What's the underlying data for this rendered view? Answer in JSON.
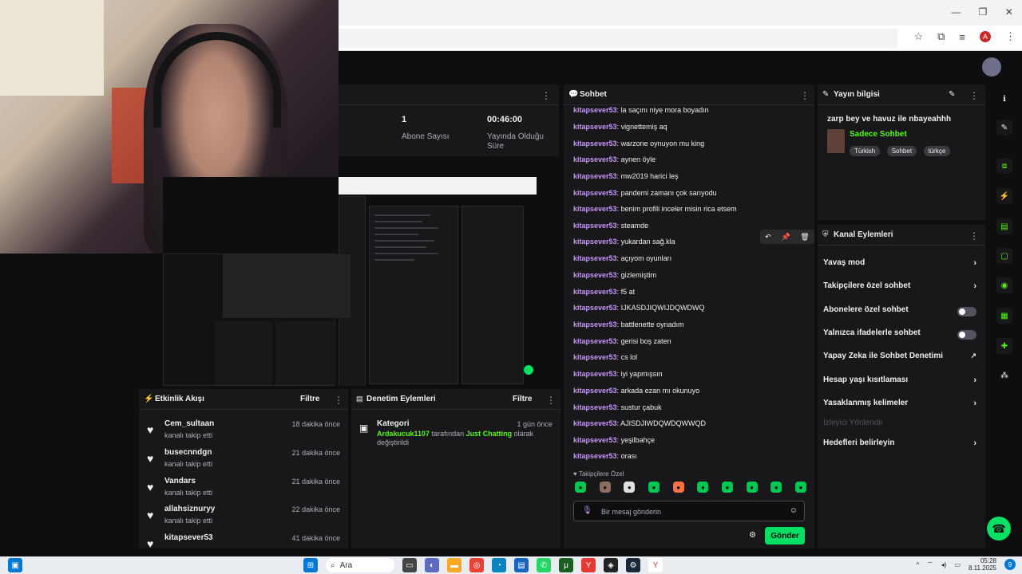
{
  "colors": {
    "accent": "#00e063",
    "username": "#c996f5",
    "bg": "#0e0e10",
    "panel": "#18181b"
  },
  "stats": [
    {
      "value": "1",
      "label": "Abone Sayısı"
    },
    {
      "value": "00:46:00",
      "label": "Yayında Olduğu Süre"
    }
  ],
  "activity": {
    "title": "Etkinlik Akışı",
    "filter_label": "Filtre",
    "items": [
      {
        "name": "Cem_sultaan",
        "sub": "kanalı takip etti",
        "time": "18 dakika önce"
      },
      {
        "name": "busecnndgn",
        "sub": "kanalı takip etti",
        "time": "21 dakika önce"
      },
      {
        "name": "Vandars",
        "sub": "kanalı takip etti",
        "time": "21 dakika önce"
      },
      {
        "name": "allahsiznuryy",
        "sub": "kanalı takip etti",
        "time": "22 dakika önce"
      },
      {
        "name": "kitapsever53",
        "sub": "",
        "time": "41 dakika önce"
      }
    ]
  },
  "mod": {
    "title": "Denetim Eylemleri",
    "filter_label": "Filtre",
    "entry": {
      "title": "Kategori",
      "time": "1 gün önce",
      "actor": "Ardakucuk1107",
      "mid": "tarafından",
      "category": "Just Chatting",
      "after": "olarak",
      "line2": "değiştirildi"
    }
  },
  "chat": {
    "title": "Sohbet",
    "user": "kitapsever53",
    "messages": [
      "la saçını niye mora boyadın",
      "vignettemiş aq",
      "warzone oynuyon mu king",
      "aynen öyle",
      "mw2019 harici leş",
      "pandemi zamanı çok sarıyodu",
      "benim profili inceler misin rica etsem",
      "steamde",
      "yukardan sağ.kla",
      "açıyom oyunları",
      "gizlemiştim",
      "f5 at",
      "IJKASDJIQWIJDQWDWQ",
      "battlenette oynadım",
      "gerisi boş zaten",
      "cs lol",
      "iyi yapmışsın",
      "arkada ezan mı okunuyo",
      "sustur çabuk",
      "AJISDJIWDQWDQWWQD",
      "yeşilbahçe",
      "orası"
    ],
    "followers_only_label": "Takipçilere Özel",
    "input_placeholder": "Bir mesaj gönderin",
    "send_label": "Gönder"
  },
  "stream_info": {
    "title": "Yayın bilgisi",
    "stream_title": "zarp bey ve havuz ile nbayeahhh",
    "category": "Sadece Sohbet",
    "tags": [
      "Türkish",
      "Sohbet",
      "türkçe"
    ]
  },
  "channel_actions": {
    "title": "Kanal Eylemleri",
    "items": [
      {
        "label": "Yavaş mod",
        "control": "chevron"
      },
      {
        "label": "Takipçilere özel sohbet",
        "control": "chevron"
      },
      {
        "label": "Abonelere özel sohbet",
        "control": "toggle"
      },
      {
        "label": "Yalnızca ifadelerle sohbet",
        "control": "toggle"
      },
      {
        "label": "Yapay Zeka ile Sohbet Denetimi",
        "control": "external"
      },
      {
        "label": "Hesap yaşı kısıtlaması",
        "control": "chevron"
      },
      {
        "label": "Yasaklanmış kelimeler",
        "control": "chevron"
      },
      {
        "label": "İzleyici Yönlendir",
        "control": "none"
      },
      {
        "label": "Hedefleri belirleyin",
        "control": "chevron"
      }
    ]
  },
  "taskbar": {
    "search_label": "Ara",
    "time": "05:28",
    "date": "8.11.2025",
    "notif_count": "9"
  }
}
